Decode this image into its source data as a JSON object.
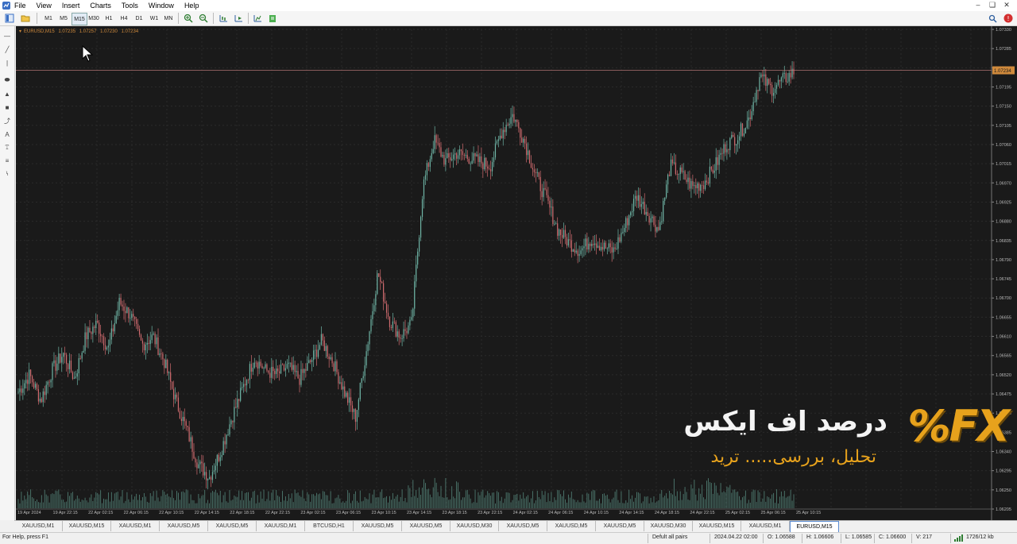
{
  "menubar": {
    "items": [
      "File",
      "View",
      "Insert",
      "Charts",
      "Tools",
      "Window",
      "Help"
    ]
  },
  "toolbar": {
    "timeframes": [
      "M1",
      "M5",
      "M15",
      "M30",
      "H1",
      "H4",
      "D1",
      "W1",
      "MN"
    ],
    "active_timeframe": "M15"
  },
  "chart": {
    "symbol_label": "EURUSD,M15",
    "ohlc_header": [
      "1.07235",
      "1.07257",
      "1.07230",
      "1.07234"
    ],
    "current_price": "1.07234",
    "colors": {
      "background": "#1a1a1a",
      "bull": "#6fb5a6",
      "bear": "#d06b6f",
      "grid": "#2a2a2a",
      "axis_text": "#bbbbbb",
      "label": "#d08a3c",
      "price_tag": "#d08a3c"
    }
  },
  "chart_data": {
    "type": "candlestick",
    "symbol": "EURUSD",
    "timeframe": "M15",
    "y_ticks": [
      "1.07330",
      "1.07285",
      "1.07240",
      "1.07195",
      "1.07150",
      "1.07105",
      "1.07060",
      "1.07015",
      "1.06970",
      "1.06925",
      "1.06880",
      "1.06835",
      "1.06790",
      "1.06745",
      "1.06700",
      "1.06655",
      "1.06610",
      "1.06565",
      "1.06520",
      "1.06475",
      "1.06430",
      "1.06385",
      "1.06340",
      "1.06295",
      "1.06250",
      "1.06205"
    ],
    "x_ticks": [
      "19 Apr 2024",
      "19 Apr 22:15",
      "22 Apr 02:15",
      "22 Apr 06:15",
      "22 Apr 10:15",
      "22 Apr 14:15",
      "22 Apr 18:15",
      "22 Apr 22:15",
      "23 Apr 02:15",
      "23 Apr 06:15",
      "23 Apr 10:15",
      "23 Apr 14:15",
      "23 Apr 18:15",
      "23 Apr 22:15",
      "24 Apr 02:15",
      "24 Apr 06:15",
      "24 Apr 10:15",
      "24 Apr 14:15",
      "24 Apr 18:15",
      "24 Apr 22:15",
      "25 Apr 02:15",
      "25 Apr 06:15",
      "25 Apr 10:15"
    ],
    "ylim": [
      1.06205,
      1.0733
    ],
    "close_path": [
      1.0648,
      1.0652,
      1.0646,
      1.0653,
      1.0657,
      1.0651,
      1.0661,
      1.0664,
      1.0658,
      1.0669,
      1.0666,
      1.0659,
      1.0661,
      1.0655,
      1.0646,
      1.0639,
      1.0631,
      1.0628,
      1.0634,
      1.0642,
      1.0649,
      1.0656,
      1.0653,
      1.0652,
      1.0654,
      1.0651,
      1.0655,
      1.066,
      1.0655,
      1.0648,
      1.0642,
      1.0658,
      1.0676,
      1.0665,
      1.0661,
      1.0664,
      1.0696,
      1.0707,
      1.0702,
      1.0704,
      1.0703,
      1.0702,
      1.0701,
      1.0709,
      1.0713,
      1.0707,
      1.0699,
      1.0693,
      1.0686,
      1.0683,
      1.0681,
      1.0684,
      1.0682,
      1.0681,
      1.0687,
      1.0694,
      1.069,
      1.0686,
      1.0701,
      1.0699,
      1.0696,
      1.0697,
      1.0701,
      1.0706,
      1.0708,
      1.0712,
      1.0722,
      1.0719,
      1.0721,
      1.0723
    ],
    "volume_shown": true
  },
  "tabs": [
    "XAUUSD,M1",
    "XAUUSD,M15",
    "XAUUSD,M1",
    "XAUUSD,M5",
    "XAUUSD,M5",
    "XAUUSD,M1",
    "BTCUSD,H1",
    "XAUUSD,M5",
    "XAUUSD,M5",
    "XAUUSD,M30",
    "XAUUSD,M5",
    "XAUUSD,M5",
    "XAUUSD,M5",
    "XAUUSD,M30",
    "XAUUSD,M15",
    "XAUUSD,M1",
    "EURUSD,M15"
  ],
  "active_tab": "EURUSD,M15",
  "statusbar": {
    "help": "For Help, press F1",
    "profile": "Defult all pairs",
    "datetime": "2024.04.22 02:00",
    "open": "O: 1.06588",
    "high": "H: 1.06606",
    "low": "L: 1.06585",
    "close": "C: 1.06600",
    "volume": "V: 217",
    "traffic": "1726/12 kb"
  },
  "watermark": {
    "logo": "%FX",
    "title": "درصد اف ایکس",
    "subtitle": "تحلیل، بررسی..... ترید"
  }
}
